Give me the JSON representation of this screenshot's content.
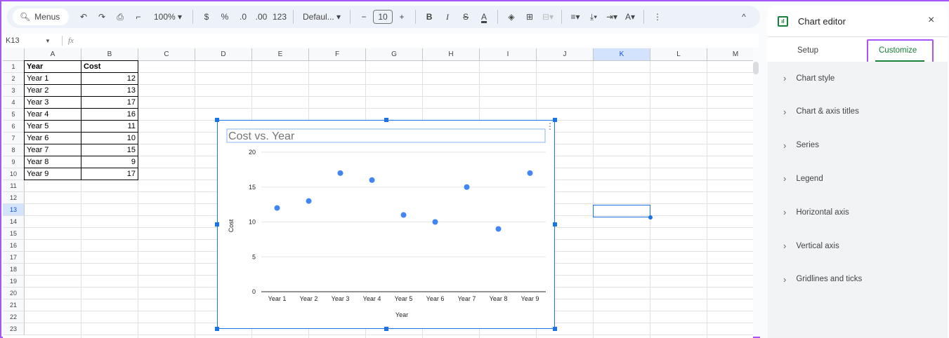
{
  "toolbar": {
    "menus_label": "Menus",
    "zoom": "100%",
    "currency": "$",
    "percent": "%",
    "dec_less": ".0",
    "dec_more": ".00",
    "format_more": "123",
    "font": "Defaul...",
    "font_size": "10",
    "bold": "B",
    "italic": "I",
    "more": "⋮"
  },
  "formula_bar": {
    "cell_ref": "K13",
    "fx": "fx",
    "value": ""
  },
  "columns": [
    "A",
    "B",
    "C",
    "D",
    "E",
    "F",
    "G",
    "H",
    "I",
    "J",
    "K",
    "L",
    "M"
  ],
  "rows": [
    "1",
    "2",
    "3",
    "4",
    "5",
    "6",
    "7",
    "8",
    "9",
    "10",
    "11",
    "12",
    "13",
    "14",
    "15",
    "16",
    "17",
    "18",
    "19",
    "20",
    "21",
    "22",
    "23"
  ],
  "table": {
    "headers": [
      "Year",
      "Cost"
    ],
    "rows": [
      [
        "Year 1",
        "12"
      ],
      [
        "Year 2",
        "13"
      ],
      [
        "Year 3",
        "17"
      ],
      [
        "Year 4",
        "16"
      ],
      [
        "Year 5",
        "11"
      ],
      [
        "Year 6",
        "10"
      ],
      [
        "Year 7",
        "15"
      ],
      [
        "Year 8",
        "9"
      ],
      [
        "Year 9",
        "17"
      ]
    ]
  },
  "selected_cell": "K13",
  "chart_data": {
    "type": "scatter",
    "title": "Cost vs. Year",
    "xlabel": "Year",
    "ylabel": "Cost",
    "categories": [
      "Year 1",
      "Year 2",
      "Year 3",
      "Year 4",
      "Year 5",
      "Year 6",
      "Year 7",
      "Year 8",
      "Year 9"
    ],
    "values": [
      12,
      13,
      17,
      16,
      11,
      10,
      15,
      9,
      17
    ],
    "ylim": [
      0,
      20
    ],
    "yticks": [
      "0",
      "5",
      "10",
      "15",
      "20"
    ],
    "grid": true,
    "legend": "none",
    "color": "#4285f4"
  },
  "chart_editor": {
    "title": "Chart editor",
    "tabs": [
      {
        "label": "Setup"
      },
      {
        "label": "Customize",
        "active": true
      }
    ],
    "sections": [
      "Chart style",
      "Chart & axis titles",
      "Series",
      "Legend",
      "Horizontal axis",
      "Vertical axis",
      "Gridlines and ticks"
    ]
  }
}
